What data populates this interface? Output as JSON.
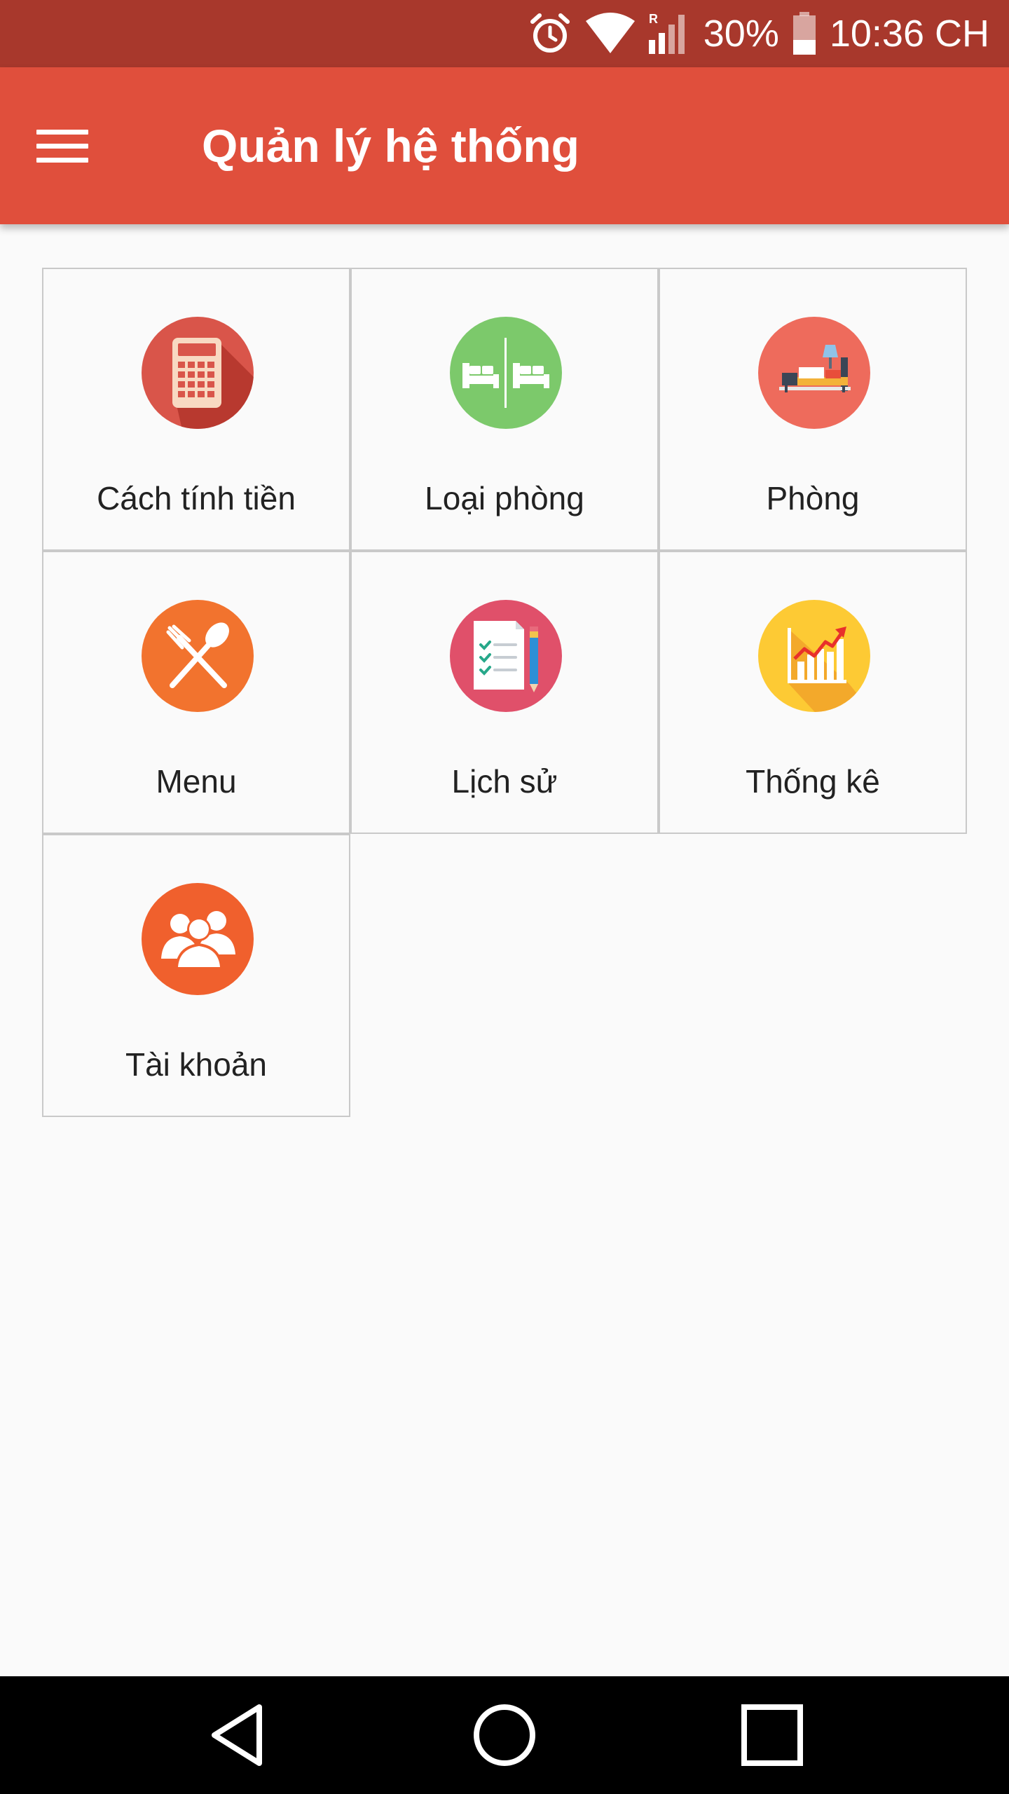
{
  "status_bar": {
    "battery": "30%",
    "time": "10:36 CH",
    "icons": [
      "alarm-icon",
      "wifi-icon",
      "signal-icon",
      "battery-icon"
    ]
  },
  "app_bar": {
    "title": "Quản lý hệ thống",
    "menu_icon": "menu-icon"
  },
  "tiles": [
    {
      "label": "Cách tính tiền",
      "icon": "calculator-icon",
      "color": "#d9554a"
    },
    {
      "label": "Loại phòng",
      "icon": "twin-beds-icon",
      "color": "#7cc96b"
    },
    {
      "label": "Phòng",
      "icon": "bedroom-icon",
      "color": "#ee6b5c"
    },
    {
      "label": "Menu",
      "icon": "fork-spoon-icon",
      "color": "#f2732e"
    },
    {
      "label": "Lịch sử",
      "icon": "checklist-icon",
      "color": "#e0506a"
    },
    {
      "label": "Thống kê",
      "icon": "growth-chart-icon",
      "color": "#fdca34"
    },
    {
      "label": "Tài khoản",
      "icon": "users-icon",
      "color": "#f0602d"
    }
  ],
  "nav_bar": {
    "back": "back-icon",
    "home": "home-icon",
    "recents": "recents-icon"
  },
  "colors": {
    "status_bar": "#a8382c",
    "app_bar": "#e04f3c",
    "background": "#fafafa"
  }
}
